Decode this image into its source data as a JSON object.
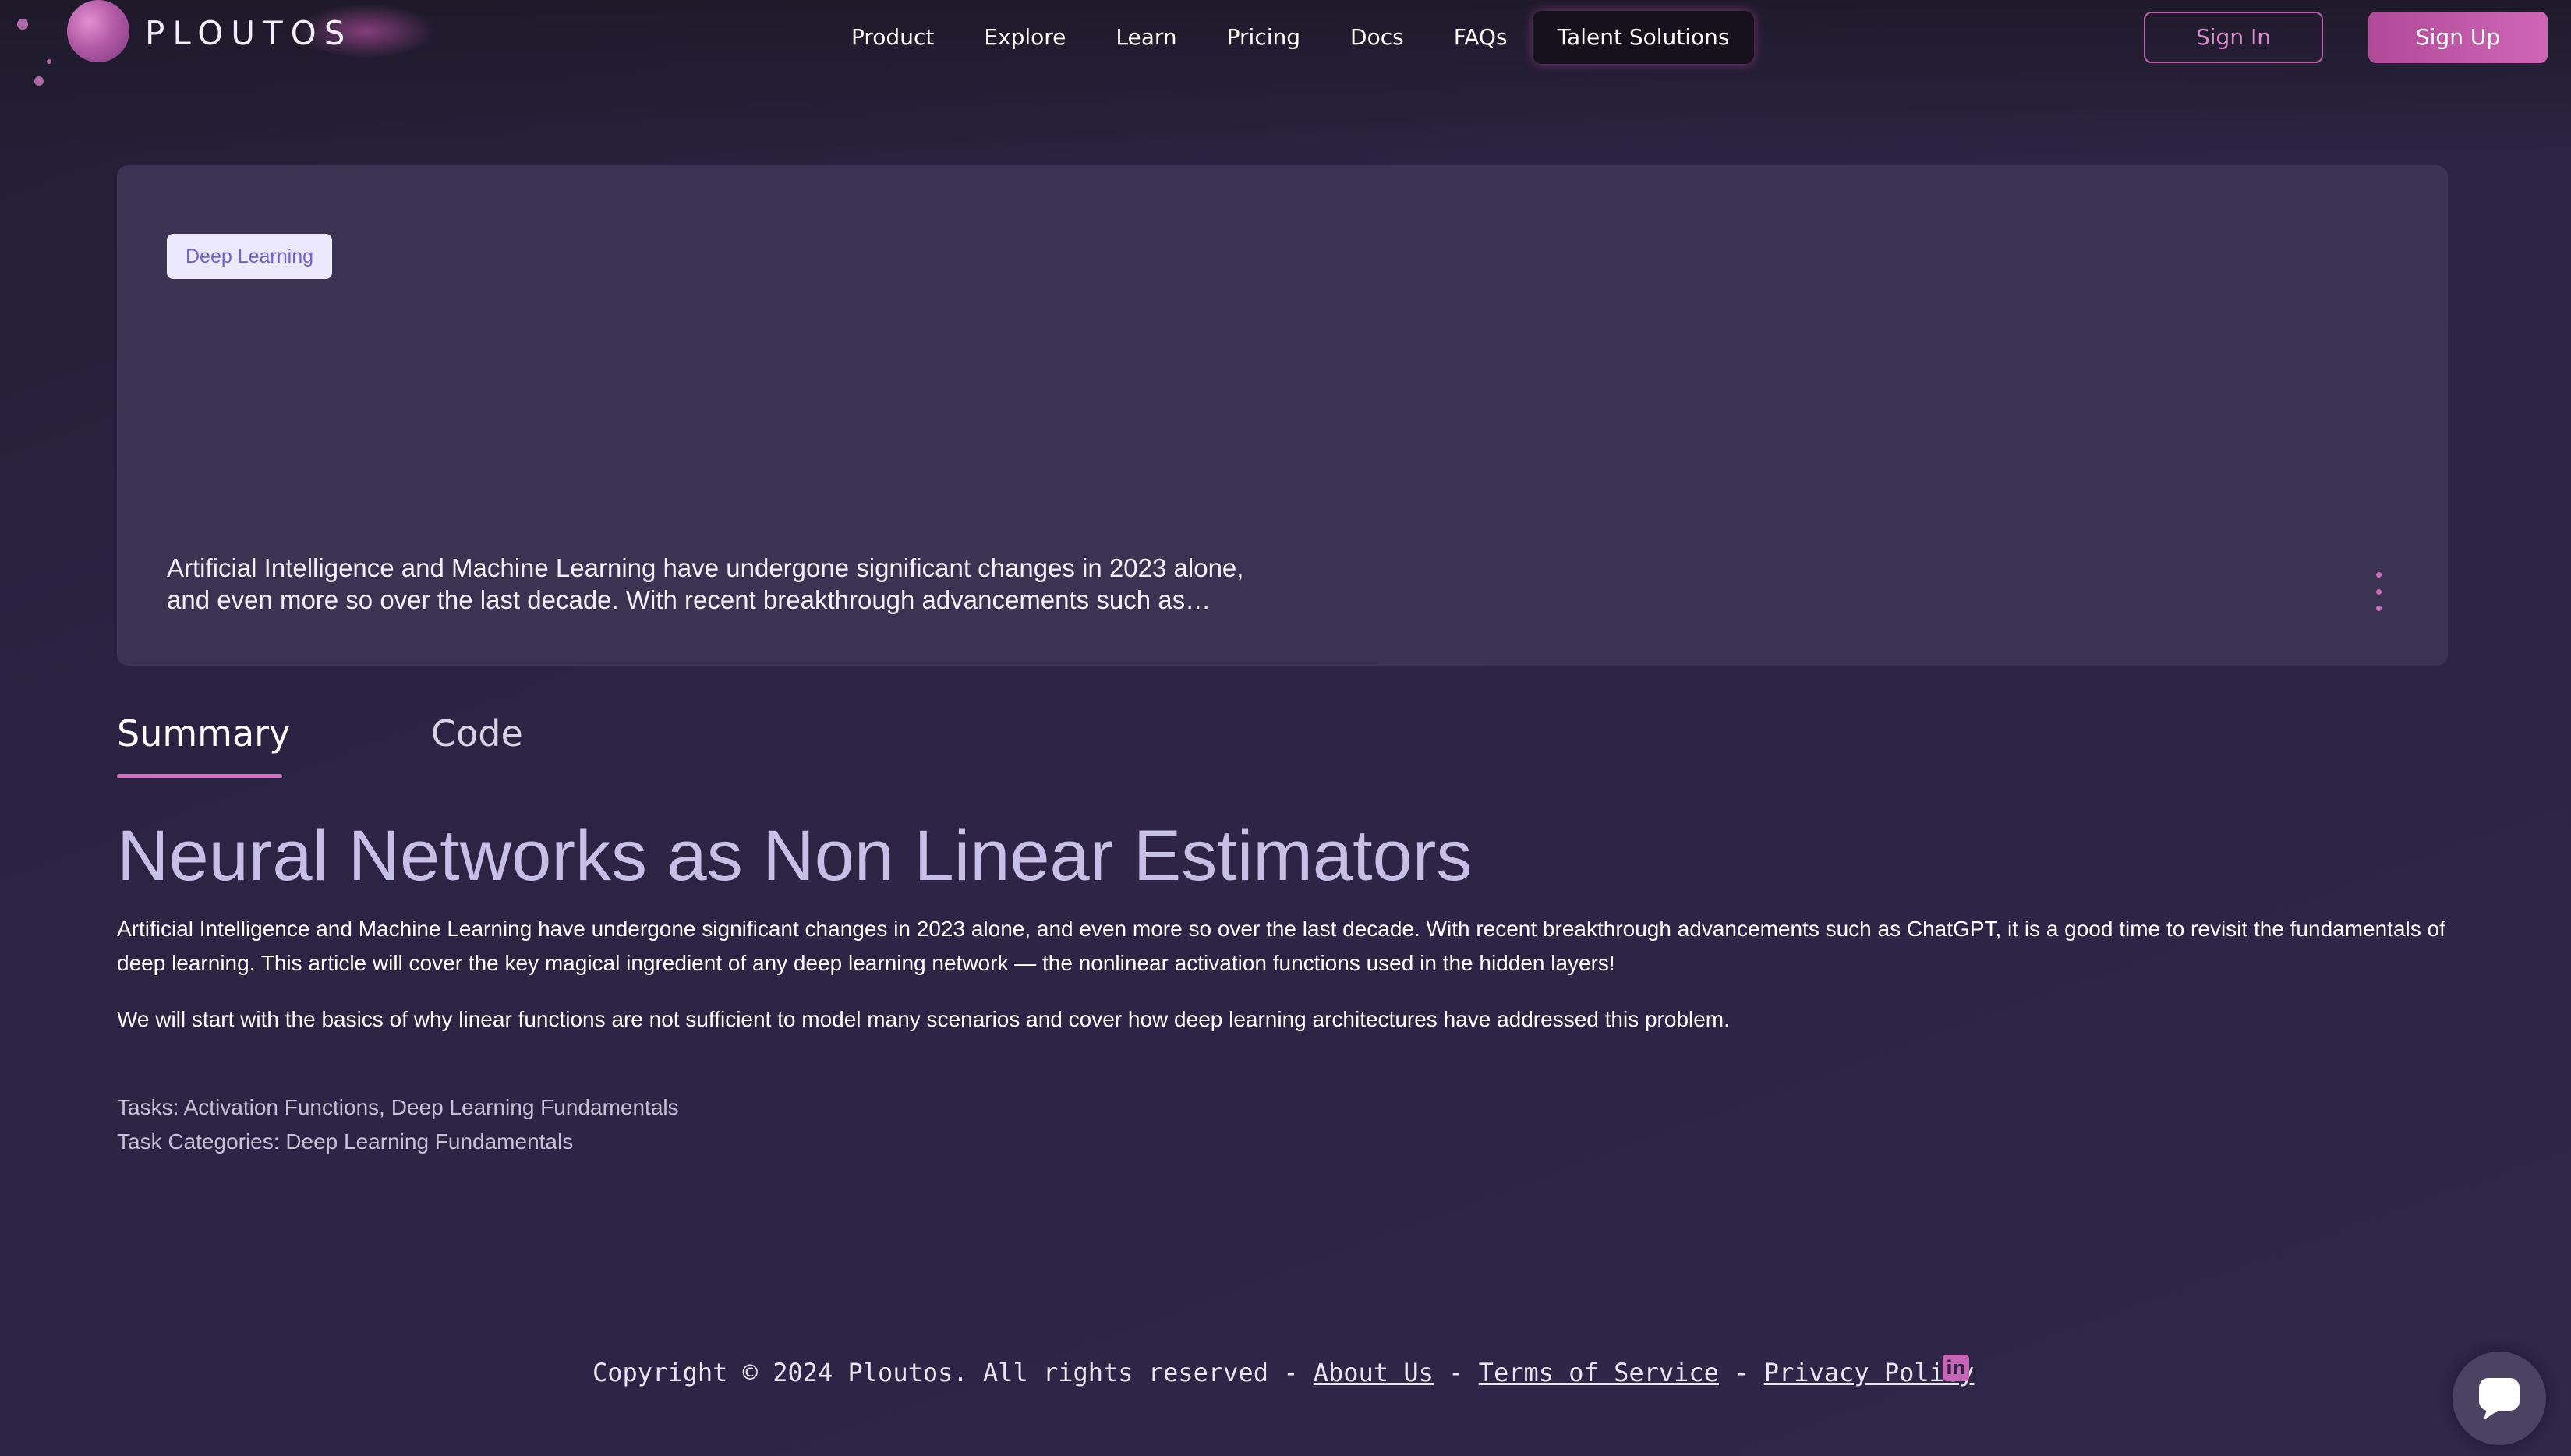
{
  "brand": {
    "name": "PLOUTOS"
  },
  "nav": {
    "items": [
      {
        "label": "Product"
      },
      {
        "label": "Explore"
      },
      {
        "label": "Learn"
      },
      {
        "label": "Pricing"
      },
      {
        "label": "Docs"
      },
      {
        "label": "FAQs"
      },
      {
        "label": "Talent Solutions",
        "active": true
      }
    ],
    "sign_in": "Sign In",
    "sign_up": "Sign Up"
  },
  "card": {
    "tag": "Deep Learning",
    "excerpt": "Artificial Intelligence and Machine Learning have undergone significant changes in 2023 alone, and even more so over the last decade. With recent breakthrough advancements such as…"
  },
  "tabs": [
    {
      "label": "Summary",
      "active": true
    },
    {
      "label": "Code",
      "active": false
    }
  ],
  "article": {
    "title": "Neural Networks as Non Linear Estimators",
    "paragraphs": [
      "Artificial Intelligence and Machine Learning have undergone significant changes in 2023 alone, and even more so over the last decade. With recent breakthrough advancements such as ChatGPT, it is a good time to revisit the fundamentals of deep learning. This article will cover the key magical ingredient of any deep learning network — the nonlinear activation functions used in the hidden layers!",
      "We will start with the basics of why linear functions are not sufficient to model many scenarios and cover how deep learning architectures have addressed this problem."
    ],
    "tasks": "Tasks: Activation Functions, Deep Learning Fundamentals",
    "task_categories": "Task Categories: Deep Learning Fundamentals"
  },
  "footer": {
    "copyright": "Copyright © 2024 Ploutos. All rights reserved",
    "separator": " - ",
    "about": "About Us",
    "terms": "Terms of Service",
    "privacy": "Privacy Policy"
  },
  "colors": {
    "accent": "#d96bc0",
    "background": "#2c2342",
    "card": "#3a3352",
    "title": "#c6bfe6"
  },
  "icons": [
    "logo-orb-icon",
    "kebab-menu-icon",
    "linkedin-icon",
    "chat-icon"
  ]
}
